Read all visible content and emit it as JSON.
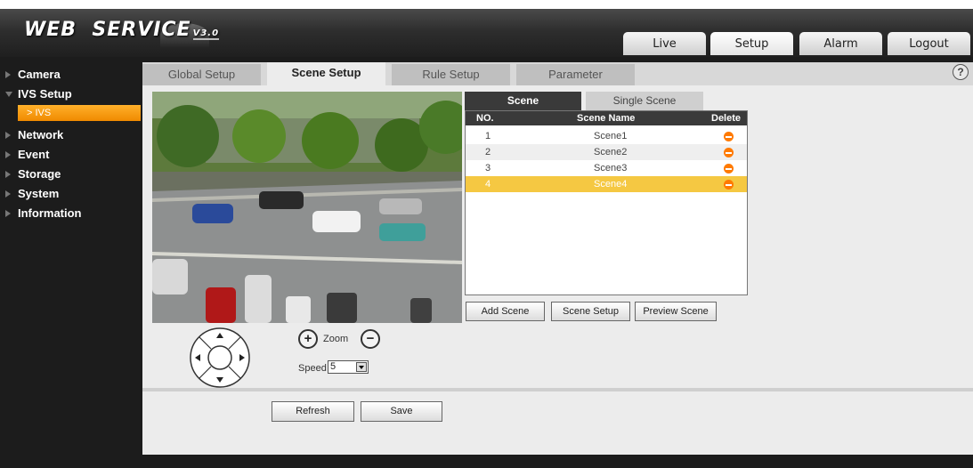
{
  "app": {
    "logo_text": "WEB  SERVICE",
    "logo_version": "V3.0"
  },
  "top_nav": [
    {
      "label": "Live",
      "active": false
    },
    {
      "label": "Setup",
      "active": true
    },
    {
      "label": "Alarm",
      "active": false
    },
    {
      "label": "Logout",
      "active": false
    }
  ],
  "sidebar": {
    "items": [
      {
        "label": "Camera",
        "expanded": false
      },
      {
        "label": "IVS Setup",
        "expanded": true
      },
      {
        "label": "Network",
        "expanded": false
      },
      {
        "label": "Event",
        "expanded": false
      },
      {
        "label": "Storage",
        "expanded": false
      },
      {
        "label": "System",
        "expanded": false
      },
      {
        "label": "Information",
        "expanded": false
      }
    ],
    "sub_item": {
      "prefix": ">",
      "label": "IVS",
      "selected": true
    }
  },
  "sub_tabs": [
    {
      "label": "Global Setup",
      "active": false
    },
    {
      "label": "Scene Setup",
      "active": true
    },
    {
      "label": "Rule Setup",
      "active": false
    },
    {
      "label": "Parameter",
      "active": false
    }
  ],
  "help_icon": "?",
  "scene_panel": {
    "tabs": [
      {
        "label": "Scene",
        "active": true
      },
      {
        "label": "Single Scene",
        "active": false
      }
    ],
    "columns": [
      "NO.",
      "Scene Name",
      "Delete"
    ],
    "rows": [
      {
        "no": "1",
        "name": "Scene1",
        "selected": false
      },
      {
        "no": "2",
        "name": "Scene2",
        "selected": false
      },
      {
        "no": "3",
        "name": "Scene3",
        "selected": false
      },
      {
        "no": "4",
        "name": "Scene4",
        "selected": true
      }
    ],
    "buttons": {
      "add": "Add Scene",
      "setup": "Scene Setup",
      "preview": "Preview Scene"
    }
  },
  "ptz": {
    "zoom_in": "+",
    "zoom_label": "Zoom",
    "zoom_out": "−",
    "speed_label": "Speed",
    "speed_value": "5"
  },
  "footer": {
    "refresh": "Refresh",
    "save": "Save"
  },
  "colors": {
    "accent_orange": "#f08a00",
    "selected_row": "#f5c842",
    "delete_icon": "#ff7a00",
    "header_dark": "#2e2e2e"
  }
}
